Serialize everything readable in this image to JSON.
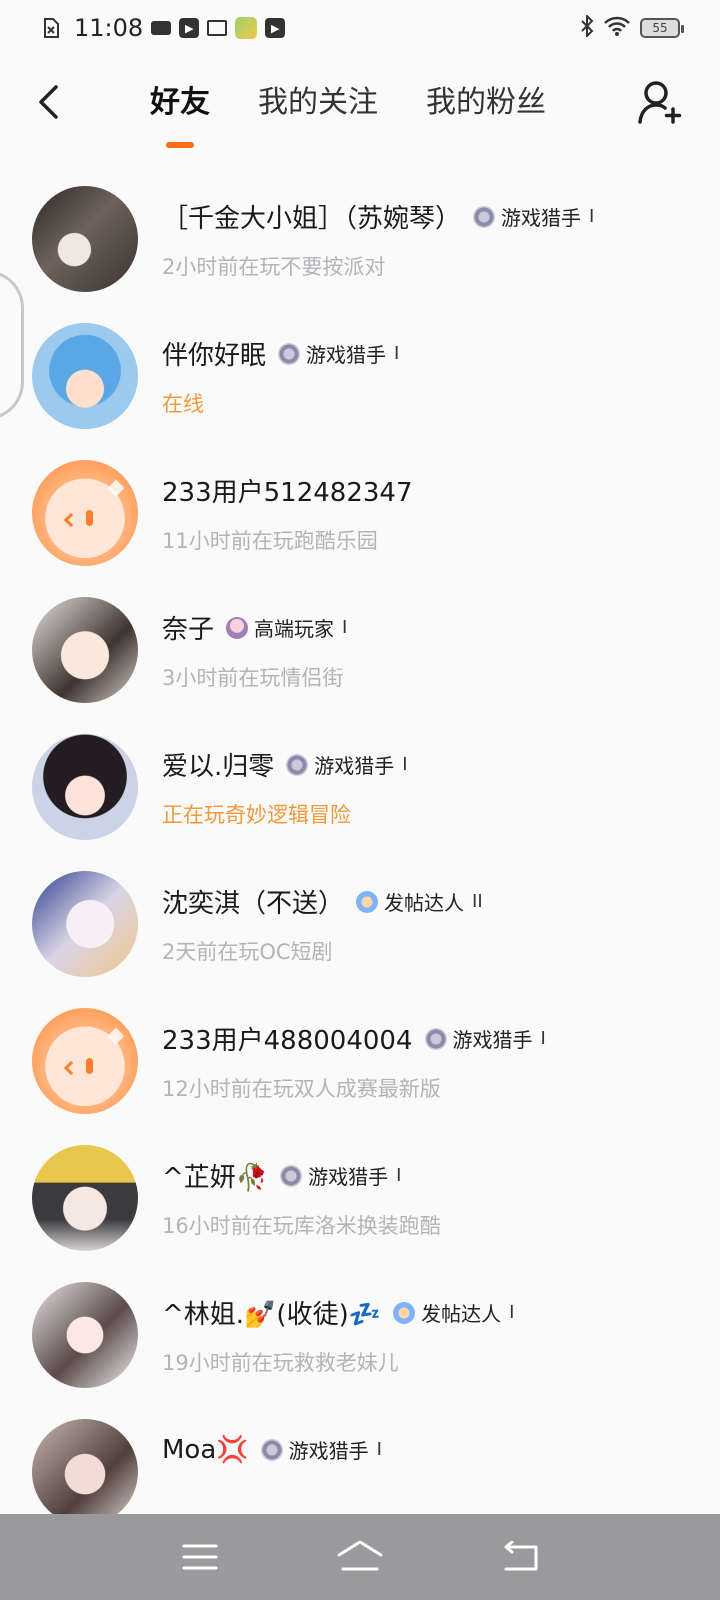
{
  "status_bar": {
    "time": "11:08",
    "battery": "55"
  },
  "header": {
    "tabs": [
      {
        "label": "好友",
        "active": true
      },
      {
        "label": "我的关注",
        "active": false
      },
      {
        "label": "我的粉丝",
        "active": false
      }
    ]
  },
  "colors": {
    "accent": "#ff6a14",
    "online": "#f29a3a",
    "secondary_text": "#b4b4b8"
  },
  "friends": [
    {
      "name": "［千金大小姐］（苏婉琴）",
      "badge": "游戏猎手",
      "badge_icon": "hunter-badge-icon",
      "level": "I",
      "status": "2小时前在玩不要按派对",
      "online": false,
      "avatar": "photo"
    },
    {
      "name": "伴你好眠",
      "badge": "游戏猎手",
      "badge_icon": "hunter-badge-icon",
      "level": "I",
      "status": "在线",
      "online": true,
      "avatar": "anime"
    },
    {
      "name": "233用户512482347",
      "badge": "",
      "badge_icon": "",
      "level": "",
      "status": "11小时前在玩跑酷乐园",
      "online": false,
      "avatar": "default"
    },
    {
      "name": "奈子",
      "badge": "高端玩家",
      "badge_icon": "pro-badge-icon",
      "level": "I",
      "status": "3小时前在玩情侣街",
      "online": false,
      "avatar": "photo"
    },
    {
      "name": "爱以.归零",
      "badge": "游戏猎手",
      "badge_icon": "hunter-badge-icon",
      "level": "I",
      "status": "正在玩奇妙逻辑冒险",
      "online": true,
      "avatar": "anime"
    },
    {
      "name": "沈奕淇（不送）",
      "badge": "发帖达人",
      "badge_icon": "poster-badge-icon",
      "level": "II",
      "status": "2天前在玩OC短剧",
      "online": false,
      "avatar": "anime"
    },
    {
      "name": "233用户488004004",
      "badge": "游戏猎手",
      "badge_icon": "hunter-badge-icon",
      "level": "I",
      "status": "12小时前在玩双人成赛最新版",
      "online": false,
      "avatar": "default"
    },
    {
      "name": "^芷妍🥀",
      "badge": "游戏猎手",
      "badge_icon": "hunter-badge-icon",
      "level": "I",
      "status": "16小时前在玩库洛米换装跑酷",
      "online": false,
      "avatar": "photo"
    },
    {
      "name": "^林姐.💅(收徒)💤",
      "badge": "发帖达人",
      "badge_icon": "poster-badge-icon",
      "level": "I",
      "status": "19小时前在玩救救老妹儿",
      "online": false,
      "avatar": "photo"
    },
    {
      "name": "Moa💢",
      "badge": "游戏猎手",
      "badge_icon": "hunter-badge-icon",
      "level": "I",
      "status": "",
      "online": false,
      "avatar": "photo"
    }
  ]
}
